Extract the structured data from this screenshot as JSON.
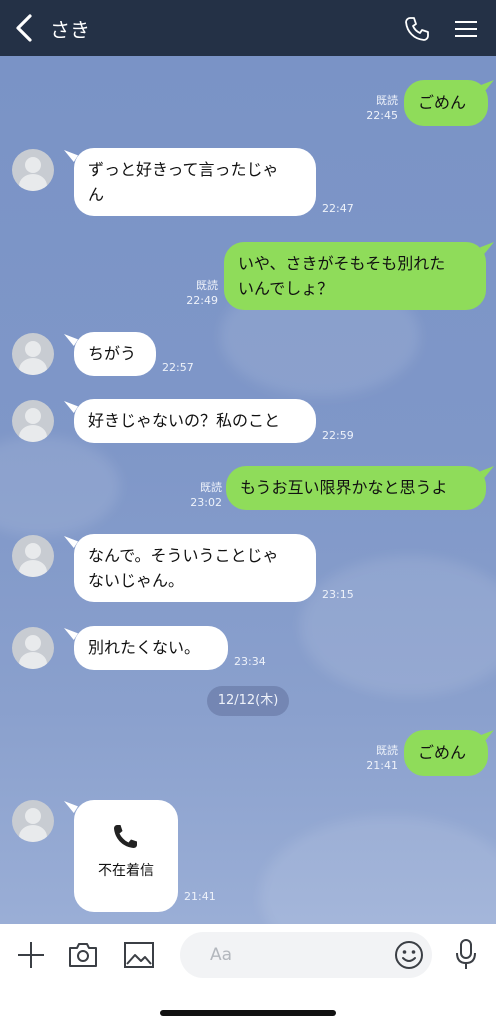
{
  "header": {
    "title": "さき"
  },
  "messages": [
    {
      "side": "right",
      "text": "ごめん",
      "read": "既読",
      "time": "22:45"
    },
    {
      "side": "left",
      "text_lines": [
        "ずっと好きって言ったじゃ",
        "ん"
      ],
      "time": "22:47"
    },
    {
      "side": "right",
      "text_lines": [
        "いや、さきがそもそも別れた",
        "いんでしょ？"
      ],
      "read": "既読",
      "time": "22:49"
    },
    {
      "side": "left",
      "text": "ちがう",
      "time": "22:57"
    },
    {
      "side": "left",
      "text": "好きじゃないの？私のこと",
      "time": "22:59"
    },
    {
      "side": "right",
      "text": "もうお互い限界かなと思うよ",
      "read": "既読",
      "time": "23:02"
    },
    {
      "side": "left",
      "text_lines": [
        "なんで。そういうことじゃ",
        "ないじゃん。"
      ],
      "time": "23:15"
    },
    {
      "side": "left",
      "text": "別れたくない。",
      "time": "23:34"
    },
    {
      "side": "date",
      "text": "12/12(木)"
    },
    {
      "side": "right",
      "text": "ごめん",
      "read": "既読",
      "time": "21:41"
    },
    {
      "side": "left",
      "type": "missed-call",
      "text": "不在着信",
      "time": "21:41"
    }
  ],
  "input": {
    "placeholder": "Aa"
  },
  "colors": {
    "header": "#243146",
    "my_bubble": "#8fdc5a",
    "their_bubble": "#ffffff",
    "background": "#7f97c8"
  }
}
